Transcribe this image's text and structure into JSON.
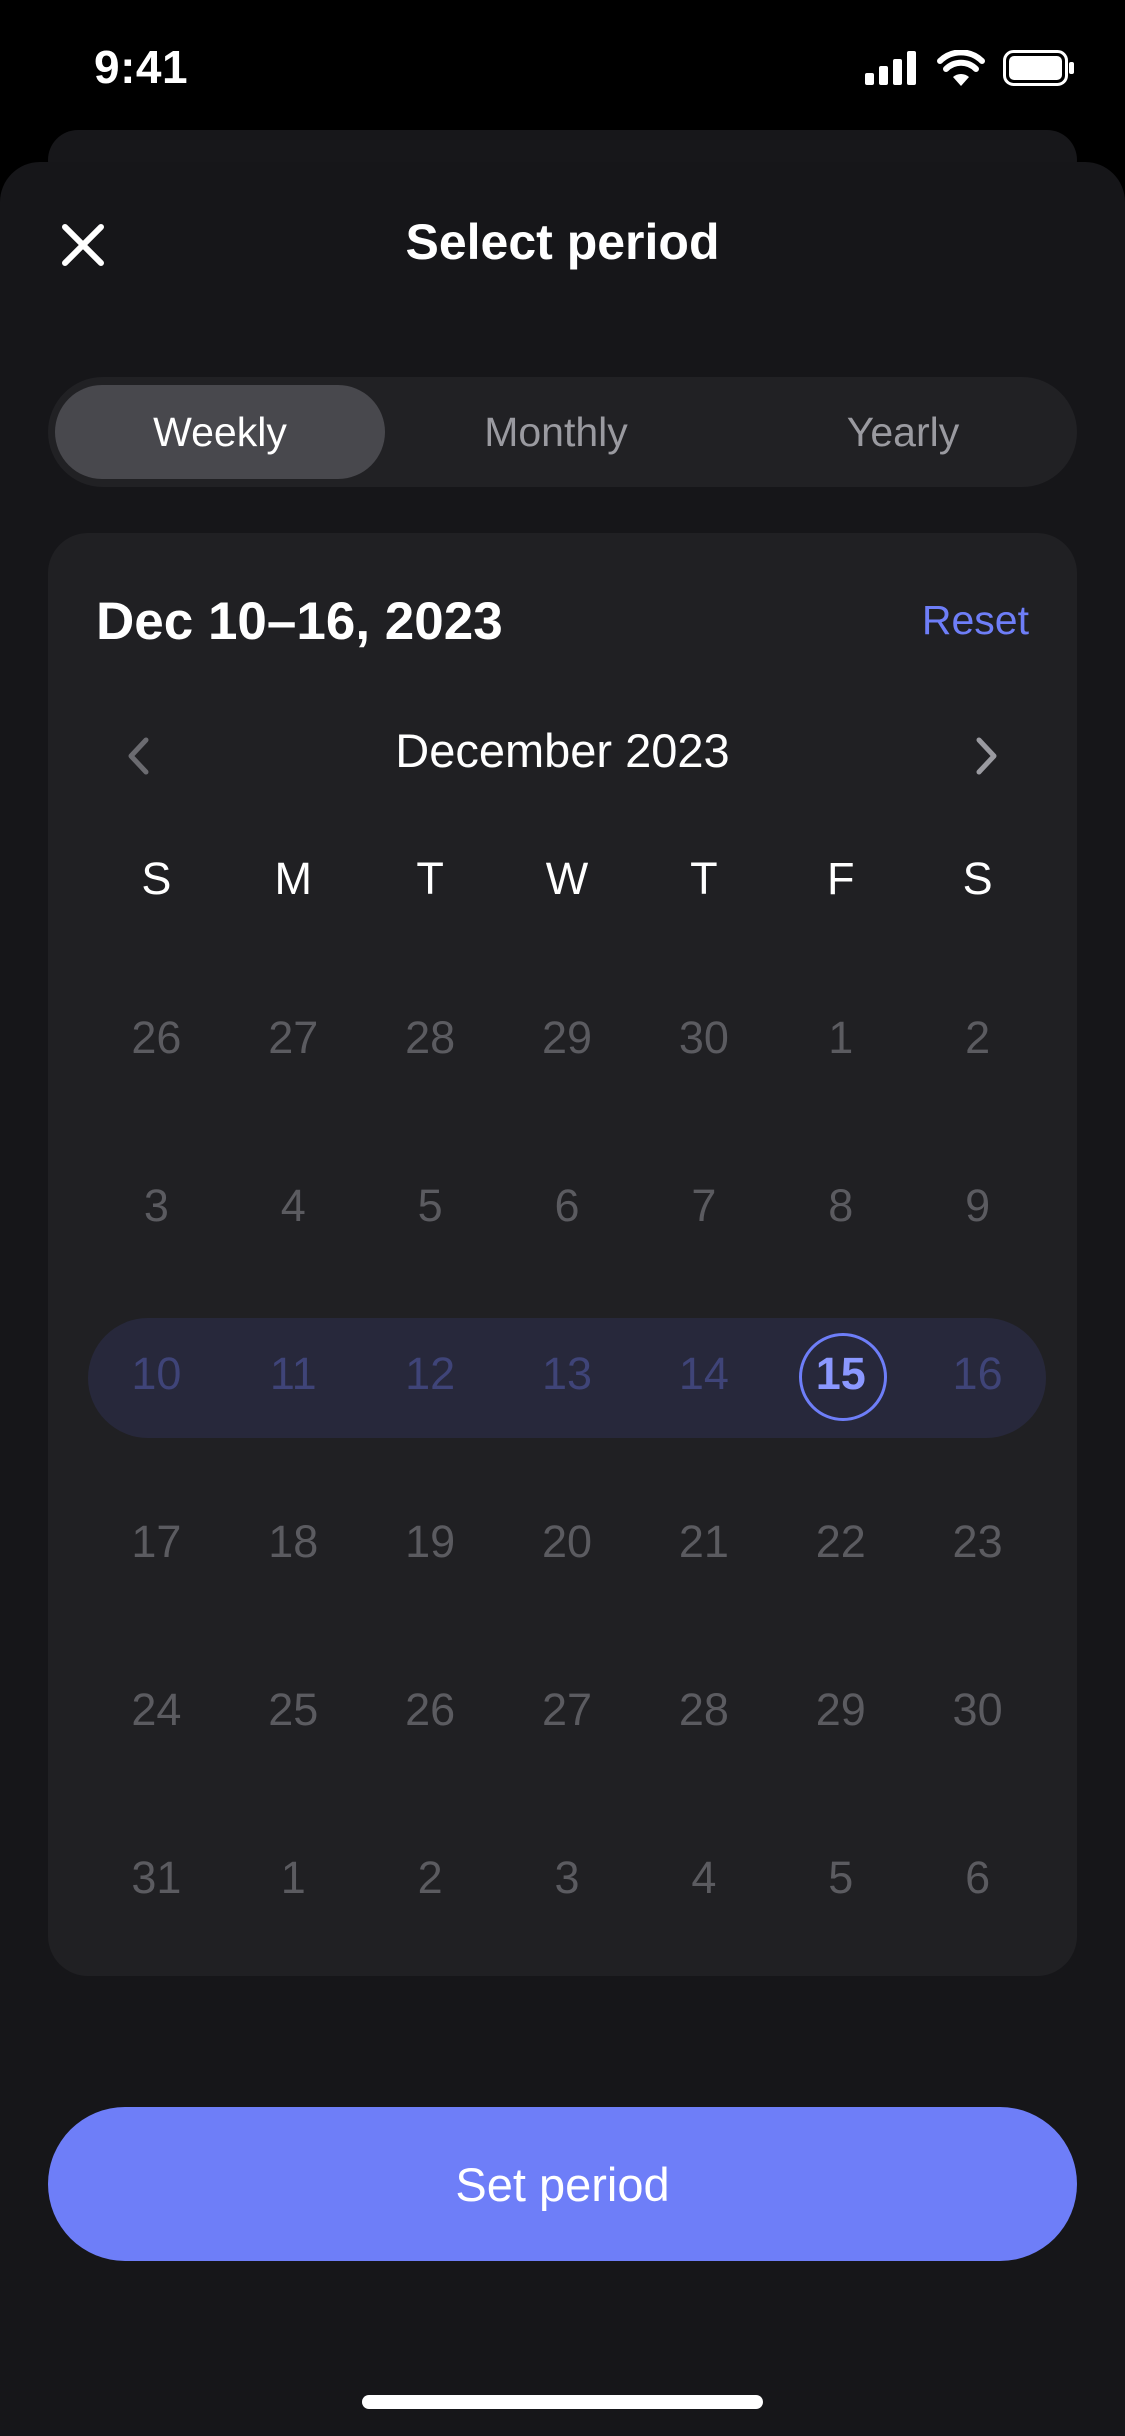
{
  "status_bar": {
    "time": "9:41"
  },
  "header": {
    "title": "Select period",
    "close_icon": "close-icon"
  },
  "tabs": [
    {
      "label": "Weekly",
      "selected": true
    },
    {
      "label": "Monthly",
      "selected": false
    },
    {
      "label": "Yearly",
      "selected": false
    }
  ],
  "calendar": {
    "range_label": "Dec 10–16, 2023",
    "reset_label": "Reset",
    "month_label": "December 2023",
    "weekdays": [
      "S",
      "M",
      "T",
      "W",
      "T",
      "F",
      "S"
    ],
    "weeks": [
      [
        "26",
        "27",
        "28",
        "29",
        "30",
        "1",
        "2"
      ],
      [
        "3",
        "4",
        "5",
        "6",
        "7",
        "8",
        "9"
      ],
      [
        "10",
        "11",
        "12",
        "13",
        "14",
        "15",
        "16"
      ],
      [
        "17",
        "18",
        "19",
        "20",
        "21",
        "22",
        "23"
      ],
      [
        "24",
        "25",
        "26",
        "27",
        "28",
        "29",
        "30"
      ],
      [
        "31",
        "1",
        "2",
        "3",
        "4",
        "5",
        "6"
      ]
    ],
    "highlighted_week_index": 2,
    "selected_day": "15"
  },
  "primary_button": {
    "label": "Set period"
  },
  "colors": {
    "accent": "#6e7ef8",
    "background": "#161619",
    "card": "#202023",
    "range_highlight": "#27283b"
  }
}
